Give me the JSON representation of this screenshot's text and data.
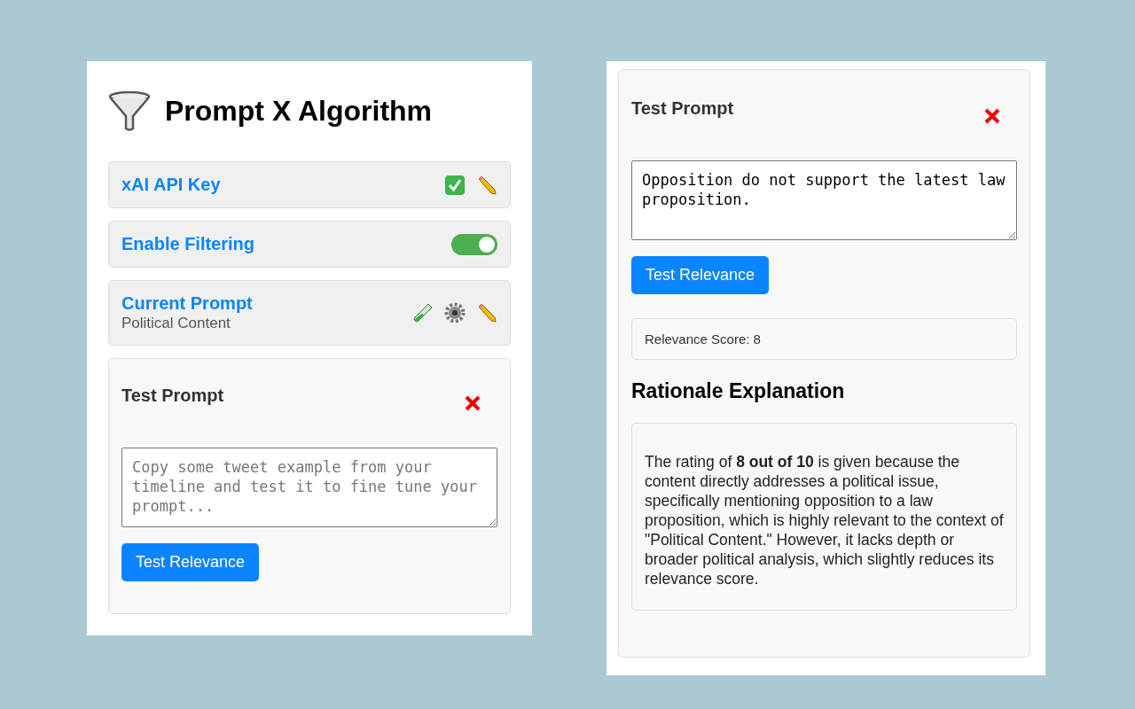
{
  "left_panel": {
    "title": "Prompt X Algorithm",
    "settings": [
      {
        "kind": "api_key",
        "label": "xAI API Key",
        "verified": true
      },
      {
        "kind": "toggle",
        "label": "Enable Filtering",
        "on": true
      },
      {
        "kind": "prompt",
        "label": "Current Prompt",
        "subtitle": "Political Content"
      }
    ],
    "test_card": {
      "title": "Test Prompt",
      "placeholder": "Copy some tweet example from your timeline and test it to fine tune your prompt...",
      "button": "Test Relevance"
    }
  },
  "right_panel": {
    "test_card": {
      "title": "Test Prompt",
      "value": "Opposition do not support the latest law proposition.",
      "button": "Test Relevance",
      "score": "Relevance Score: 8",
      "rationale_title": "Rationale Explanation",
      "rationale": "The rating of **8 out of 10** is given because the content directly addresses a political issue, specifically mentioning opposition to a law proposition, which is highly relevant to the context of \"Political Content.\" However, it lacks depth or broader political analysis, which slightly reduces its relevance score."
    }
  }
}
